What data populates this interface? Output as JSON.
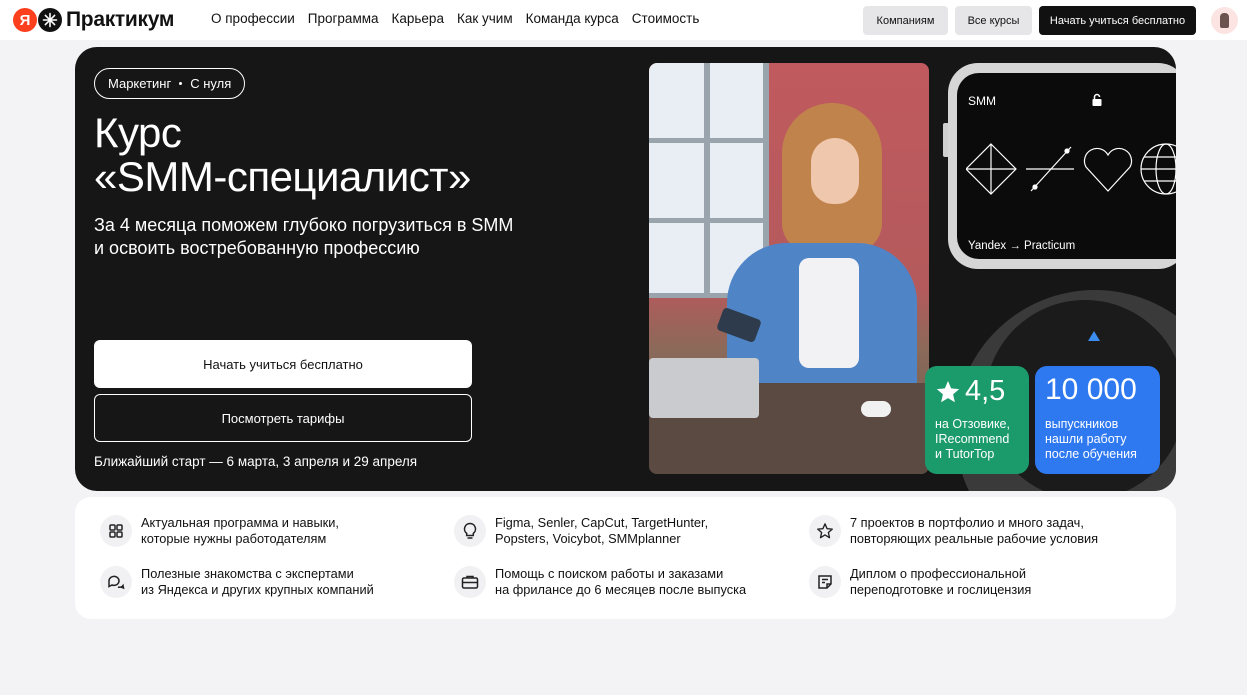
{
  "header": {
    "logo_ya": "Я",
    "logo_text": "Практикум",
    "nav": [
      "О профессии",
      "Программа",
      "Карьера",
      "Как учим",
      "Команда курса",
      "Стоимость"
    ],
    "companies_label": "Компаниям",
    "all_courses_label": "Все курсы",
    "start_free_label": "Начать учиться бесплатно"
  },
  "hero": {
    "tag_category": "Маркетинг",
    "tag_level": "С нуля",
    "title_line1": "Курс",
    "title_line2": "«SMM-специалист»",
    "subtitle_line1": "За 4 месяца поможем глубоко погрузиться в SMM",
    "subtitle_line2": "и освоить востребованную профессию",
    "primary_button": "Начать учиться бесплатно",
    "secondary_button": "Посмотреть тарифы",
    "start_note": "Ближайший старт — 6 марта, 3 апреля и 29 апреля",
    "device": {
      "label": "SMM",
      "brand": "Yandex → Practicum"
    },
    "rating_card": {
      "value": "4,5",
      "line1": "на Отзовике,",
      "line2": "IRecommend",
      "line3": "и TutorTop",
      "color": "#1b9a6c"
    },
    "graduates_card": {
      "value": "10 000",
      "line1": "выпускников",
      "line2": "нашли работу",
      "line3": "после обучения",
      "color": "#2f79f0"
    }
  },
  "features": [
    {
      "icon": "grid-icon",
      "line1": "Актуальная программа и навыки,",
      "line2": "которые нужны работодателям"
    },
    {
      "icon": "lightbulb-icon",
      "line1": "Figma, Senler, CapCut, TargetHunter,",
      "line2": "Popsters, Voicybot, SMMplanner"
    },
    {
      "icon": "star-icon",
      "line1": "7 проектов в портфолио и много задач,",
      "line2": "повторяющих реальные рабочие условия"
    },
    {
      "icon": "chat-icon",
      "line1": "Полезные знакомства с экспертами",
      "line2": "из Яндекса и других крупных компаний"
    },
    {
      "icon": "briefcase-icon",
      "line1": "Помощь с поиском работы и заказами",
      "line2": "на фрилансе до 6 месяцев после выпуска"
    },
    {
      "icon": "diploma-icon",
      "line1": "Диплом о профессиональной",
      "line2": "переподготовке и гослицензия"
    }
  ]
}
